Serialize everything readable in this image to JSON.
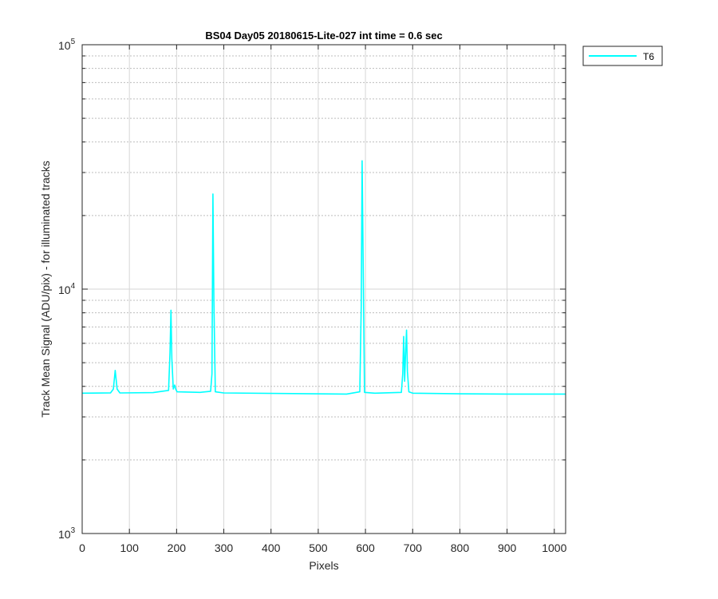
{
  "chart_data": {
    "type": "line",
    "title": "BS04 Day05 20180615-Lite-027 int time = 0.6 sec",
    "xlabel": "Pixels",
    "ylabel": "Track Mean Signal (ADU/pix) - for illuminated tracks",
    "xlim": [
      0,
      1024
    ],
    "ylim": [
      1000,
      100000
    ],
    "yscale": "log",
    "grid": true,
    "legend_position": "outside-top-right",
    "x_ticks": [
      "0",
      "100",
      "200",
      "300",
      "400",
      "500",
      "600",
      "700",
      "800",
      "900",
      "1000"
    ],
    "y_ticks": [
      {
        "base": "10",
        "exp": "3"
      },
      {
        "base": "10",
        "exp": "4"
      },
      {
        "base": "10",
        "exp": "5"
      }
    ],
    "series": [
      {
        "name": "T6",
        "color": "#00ffff",
        "x": [
          0,
          60,
          66,
          70,
          74,
          80,
          150,
          183,
          186,
          188,
          190,
          193,
          196,
          198,
          201,
          250,
          272,
          275,
          277,
          279,
          282,
          300,
          560,
          588,
          591,
          593,
          595,
          598,
          620,
          676,
          679,
          681,
          683,
          685,
          687,
          689,
          692,
          700,
          800,
          900,
          1024
        ],
        "values": [
          3750,
          3760,
          3900,
          4650,
          3900,
          3760,
          3770,
          3850,
          5500,
          8200,
          5200,
          3900,
          4050,
          3900,
          3800,
          3780,
          3820,
          4500,
          24500,
          9000,
          3800,
          3760,
          3720,
          3800,
          8500,
          33500,
          14000,
          3780,
          3750,
          3780,
          4500,
          6400,
          4200,
          5500,
          6800,
          4600,
          3800,
          3750,
          3730,
          3720,
          3720
        ]
      }
    ]
  }
}
